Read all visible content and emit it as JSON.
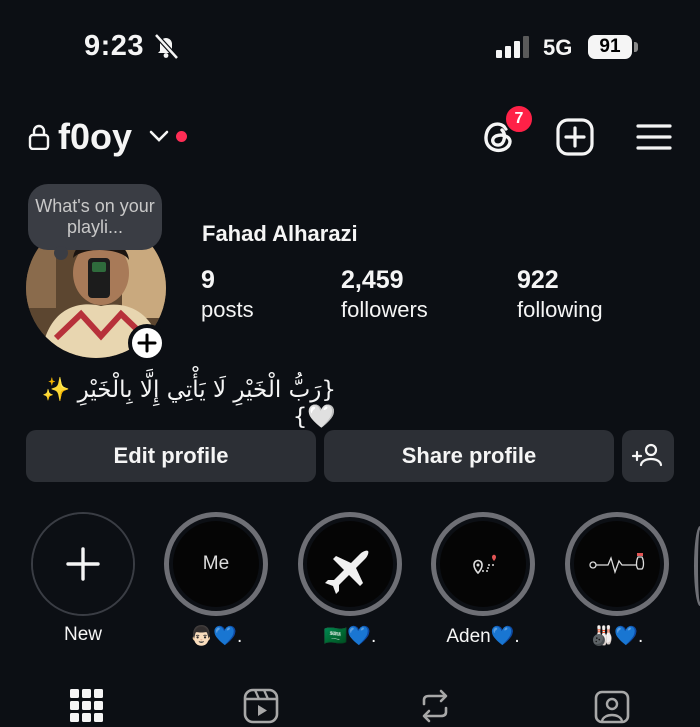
{
  "status_bar": {
    "time": "9:23",
    "network": "5G",
    "battery": "91"
  },
  "header": {
    "username": "f0oy",
    "threads_badge": "7"
  },
  "profile": {
    "note": "What's on your playli...",
    "full_name": "Fahad Alharazi",
    "stats": [
      {
        "num": "9",
        "label": "posts"
      },
      {
        "num": "2,459",
        "label": "followers"
      },
      {
        "num": "922",
        "label": "following"
      }
    ],
    "bio": "{رَبُّ الْخَيْرِ لَا يَأْتِي إِلَّا بِالْخَيْرِ ✨🤍}"
  },
  "buttons": {
    "edit": "Edit profile",
    "share": "Share profile"
  },
  "highlights": [
    {
      "label": "New",
      "inner_text": ""
    },
    {
      "label": "👨🏻💙.",
      "inner_text": "Me"
    },
    {
      "label": "🇸🇦💙.",
      "inner_text": ""
    },
    {
      "label": "Aden💙.",
      "inner_text": ""
    },
    {
      "label": "🎳💙.",
      "inner_text": ""
    }
  ],
  "icons": {
    "bell": "bell-slash-icon",
    "lock": "lock-icon",
    "threads": "threads-icon",
    "create": "plus-square-icon",
    "menu": "hamburger-menu-icon",
    "grid": "grid-icon",
    "reels": "reels-icon",
    "reposts": "repost-icon",
    "tagged": "tagged-icon"
  },
  "colors": {
    "background": "#0c0f14",
    "button": "#2c2f35",
    "badge": "#ff2147",
    "ring": "#6e6f75"
  }
}
